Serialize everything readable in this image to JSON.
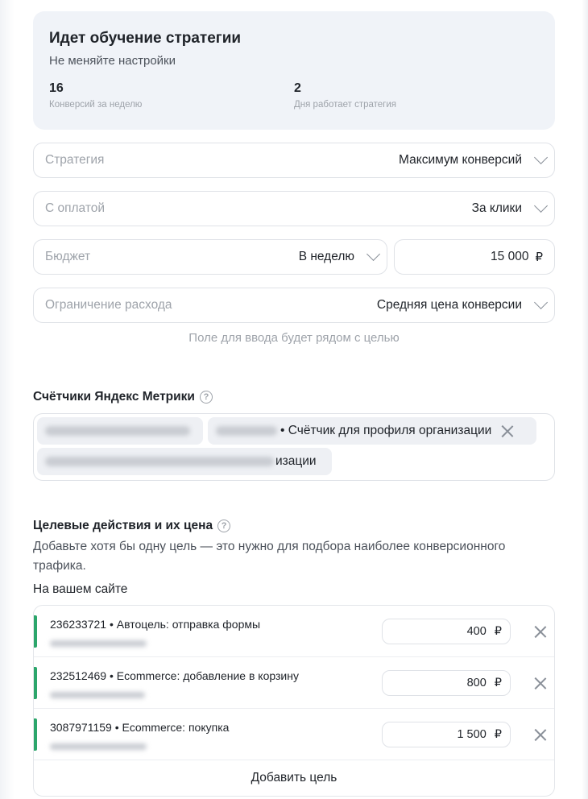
{
  "learning": {
    "title": "Идет обучение стратегии",
    "subtitle": "Не меняйте настройки",
    "stats": [
      {
        "value": "16",
        "label": "Конверсий за неделю"
      },
      {
        "value": "2",
        "label": "Дня работает стратегия"
      }
    ]
  },
  "fields": {
    "strategy": {
      "placeholder": "Стратегия",
      "value": "Максимум конверсий"
    },
    "payment": {
      "placeholder": "С оплатой",
      "value": "За клики"
    },
    "budget": {
      "placeholder": "Бюджет",
      "value": "В неделю",
      "amount": "15 000",
      "currency": "₽"
    },
    "limit": {
      "placeholder": "Ограничение расхода",
      "value": "Средняя цена конверсии"
    },
    "hint": "Поле для ввода будет рядом с целью"
  },
  "counters": {
    "title": "Счётчики Яндекс Метрики",
    "chip_text": "• Счётчик для профиля организации",
    "chip_tail": "изации"
  },
  "goals": {
    "title": "Целевые действия и их цена",
    "description": "Добавьте хотя бы одну цель — это нужно для подбора наиболее конверсионного трафика.",
    "site_label": "На вашем сайте",
    "items": [
      {
        "name": "236233721 • Автоцель: отправка формы",
        "price": "400",
        "currency": "₽"
      },
      {
        "name": "232512469 • Ecommerce: добавление в корзину",
        "price": "800",
        "currency": "₽"
      },
      {
        "name": "3087971159 • Ecommerce: покупка",
        "price": "1 500",
        "currency": "₽"
      }
    ],
    "add_label": "Добавить цель"
  },
  "colors": {
    "accent_green": "#2ca66b",
    "panel_bg": "#f0f3f8"
  }
}
